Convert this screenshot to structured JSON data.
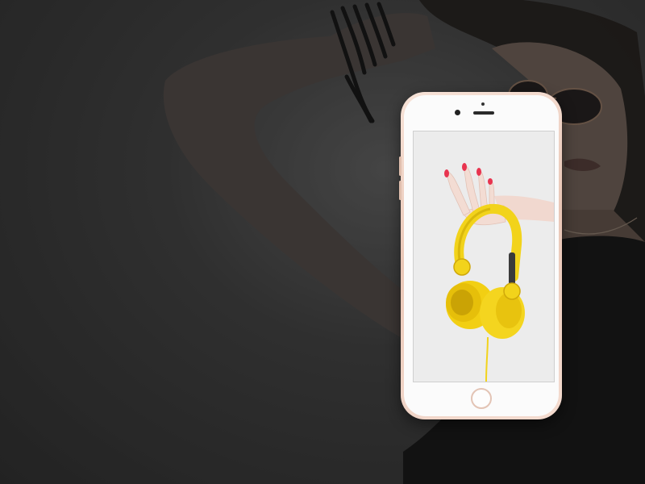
{
  "scene": {
    "subject": "woman-wearing-sunglasses",
    "device": "rose-gold-smartphone",
    "screen_content": "hand-holding-yellow-headphones"
  },
  "colors": {
    "background_overlay": "#2e2e2e",
    "phone_frame": "#f0d2c4",
    "headphones": "#f2d31b",
    "nail_polish": "#e8344f"
  }
}
